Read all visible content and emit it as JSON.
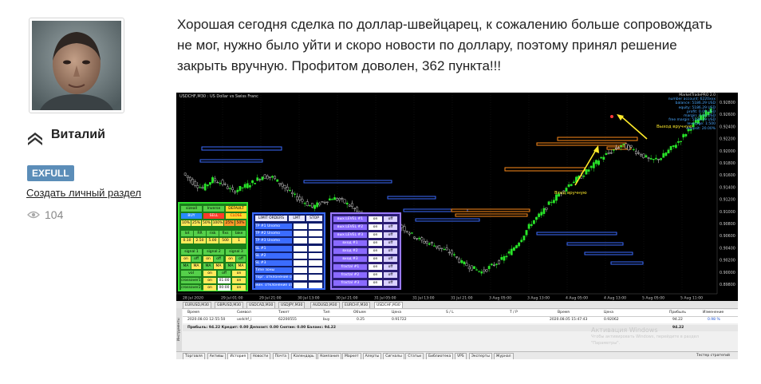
{
  "author": {
    "name": "Виталий",
    "badge": "EXFULL",
    "create_section_link": "Создать личный раздел",
    "views": "104"
  },
  "post": {
    "line1": "Хорошая сегодня сделка по доллар-швейцарец, к сожалению больше сопровождать",
    "line2": "не мог, нужно было уйти и скоро новости по доллару, поэтому принял решение",
    "line3": "закрыть вручную. Профитом доволен, 362 пункта!!!"
  },
  "terminal": {
    "chart_title": "USDCHF,M30 : US Dollar vs Swiss Franc",
    "info": {
      "l1": "MarketTradePRO 2.0",
      "l2": "number account: 6220xxx",
      "l3": "balance: 5186.29 USD",
      "l4": "equity: 5186.29 USD",
      "l5": "profit: 0.00 USD",
      "l6": "margin: 0.00 USD",
      "l7": "free margin: 5186.29 USD",
      "l8": "leverage: 1:500",
      "l9": "deposit: 20.00%"
    },
    "annotations": {
      "exit": "Выход вручную",
      "entry": "Вход вручную"
    },
    "price_labels": [
      "0.92800",
      "0.92600",
      "0.92400",
      "0.92200",
      "0.92000",
      "0.91800",
      "0.91600",
      "0.91400",
      "0.91200",
      "0.91000",
      "0.90800",
      "0.90600",
      "0.90400",
      "0.90200",
      "0.90000",
      "0.89800"
    ],
    "time_labels": [
      "28 Jul 2020",
      "29 Jul 01:00",
      "29 Jul 21:00",
      "30 Jul 13:00",
      "30 Jul 21:00",
      "31 Jul 05:00",
      "31 Jul 13:00",
      "31 Jul 21:00",
      "3 Aug 05:00",
      "3 Aug 13:00",
      "4 Aug 05:00",
      "4 Aug 13:00",
      "5 Aug 05:00",
      "5 Aug 11:00"
    ],
    "symbol_tabs": [
      "EURUSD,M30",
      "GBPUSD,M30",
      "USDCAD,M30",
      "USDJPY,M30",
      "AUDUSD,M30",
      "EURCHF,M30",
      "USDCHF,M30"
    ],
    "table_headers": {
      "time": "Время",
      "symbol": "Символ",
      "ticket": "Тикет",
      "type": "Тип",
      "volume": "Объем",
      "price": "Цена",
      "sl": "S / L",
      "tp": "T / P",
      "time2": "Время",
      "price2": "Цена",
      "profit": "Прибыль",
      "change": "Изменение"
    },
    "row": {
      "time": "2020.08.03 12:55:50",
      "symbol": "usdchf_i",
      "ticket": "62200555",
      "type": "buy",
      "volume": "0.25",
      "price": "0.91722",
      "time2": "2020.08.05 15:47:43",
      "price2": "0.92062",
      "profit": "94.22",
      "change": "0.98 %"
    },
    "summary": {
      "text": "Прибыль: 94.22  Кредит: 0.00  Депозит: 0.00  Снятие: 0.00  Баланс: 94.22",
      "profit": "94.22"
    },
    "sidebar_label": "Инструменты",
    "watermark1": "Активация Windows",
    "watermark2": "Чтобы активировать Windows, перейдите в раздел",
    "watermark3": "\"Параметры\".",
    "bottom_tabs": [
      "Торговля",
      "Активы",
      "История",
      "Новости",
      "Почта",
      "Календарь",
      "Компания",
      "Маркет",
      "Алерты",
      "Сигналы",
      "Статьи",
      "Библиотека",
      "VPS",
      "Эксперты",
      "Журнал"
    ],
    "tester_label": "Тестер стратегий",
    "panel_green": {
      "r1": [
        "sizeall",
        "Inverse",
        "DEFAULT"
      ],
      "r2": [
        "BUY",
        "SELL",
        "CLOSE"
      ],
      "r3": [
        "10%",
        "25%",
        "50%",
        "100%",
        "25%",
        "50%"
      ],
      "r4": [
        "lot",
        "RR",
        "risk",
        "fixs",
        "take"
      ],
      "r5": [
        "0.10",
        "2.50",
        "5.00",
        "500",
        "1"
      ],
      "r6": [
        "signal 1",
        "signal 2",
        "signal 3"
      ],
      "r7": [
        "on",
        "off",
        "on",
        "off",
        "on",
        "off"
      ],
      "r8": [
        "MA",
        "MA",
        "MA",
        "MA",
        "MA",
        "MA"
      ],
      "r9": [
        "vol",
        "on",
        "off",
        "on"
      ],
      "r10": [
        "crossover1",
        "on",
        "01:00",
        "on"
      ],
      "r11": [
        "crossover2",
        "on",
        "00:00",
        "on"
      ]
    },
    "panel_blue": {
      "head": [
        "LIMIT ORDERS",
        "LMT",
        "STOP"
      ],
      "rows": [
        "TP #1 Unomo",
        "TP #2 Unomo",
        "TP #3 Unomo",
        "SL #1",
        "SL #2",
        "SL #3",
        "Time зоны",
        "торг. отклонение от Т/R",
        "мин. отклонение от Т/R"
      ]
    },
    "panel_purple": {
      "rows": [
        "вых.LEVEL #1",
        "вых.LEVEL #2",
        "вых.LEVEL #3",
        "вход #1",
        "вход #2",
        "вход #3",
        "fractal #1",
        "fractal #2",
        "fractal #3"
      ],
      "btn_on": "on",
      "btn_off": "off"
    }
  },
  "chart_data": {
    "type": "candlestick",
    "title": "USDCHF,M30 : US Dollar vs Swiss Franc",
    "ylim": [
      0.8975,
      0.929
    ],
    "close_series": [
      0.9165,
      0.915,
      0.914,
      0.9155,
      0.9148,
      0.9135,
      0.9142,
      0.915,
      0.916,
      0.9158,
      0.9145,
      0.913,
      0.912,
      0.911,
      0.9118,
      0.9125,
      0.912,
      0.911,
      0.9095,
      0.908,
      0.9072,
      0.9085,
      0.9078,
      0.9065,
      0.9055,
      0.905,
      0.9042,
      0.9035,
      0.902,
      0.9012,
      0.9005,
      0.9015,
      0.9025,
      0.904,
      0.906,
      0.9085,
      0.91,
      0.912,
      0.9135,
      0.915,
      0.916,
      0.9175,
      0.919,
      0.92,
      0.921,
      0.9205,
      0.9195,
      0.9185,
      0.919,
      0.9205,
      0.922,
      0.924,
      0.9255,
      0.927
    ]
  }
}
